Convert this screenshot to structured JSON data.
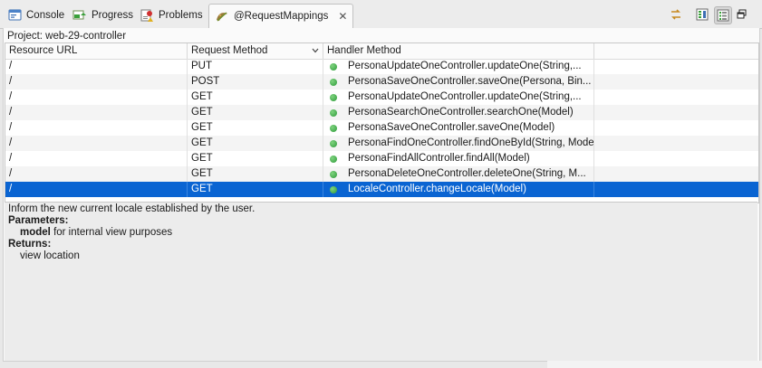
{
  "tabs": [
    {
      "label": "Console",
      "icon": "console-icon",
      "active": false
    },
    {
      "label": "Progress",
      "icon": "progress-icon",
      "active": false
    },
    {
      "label": "Problems",
      "icon": "problems-icon",
      "active": false
    },
    {
      "label": "@RequestMappings",
      "icon": "request-mappings-icon",
      "active": true
    }
  ],
  "toolbar": {
    "link_icon": "link-editor-icon",
    "layout_columns_icon": "layout-columns-icon",
    "layout_list_icon": "layout-list-icon",
    "minimize_icon": "maximize-restore-icon"
  },
  "project_label": "Project: web-29-controller",
  "table": {
    "headers": [
      "Resource URL",
      "Request Method",
      "Handler Method"
    ],
    "rows": [
      {
        "url": "/",
        "method": "PUT",
        "handler": "PersonaUpdateOneController.updateOne(String,..."
      },
      {
        "url": "/",
        "method": "POST",
        "handler": "PersonaSaveOneController.saveOne(Persona, Bin..."
      },
      {
        "url": "/",
        "method": "GET",
        "handler": "PersonaUpdateOneController.updateOne(String,..."
      },
      {
        "url": "/",
        "method": "GET",
        "handler": "PersonaSearchOneController.searchOne(Model)"
      },
      {
        "url": "/",
        "method": "GET",
        "handler": "PersonaSaveOneController.saveOne(Model)"
      },
      {
        "url": "/",
        "method": "GET",
        "handler": "PersonaFindOneController.findOneById(String, Model)"
      },
      {
        "url": "/",
        "method": "GET",
        "handler": "PersonaFindAllController.findAll(Model)"
      },
      {
        "url": "/",
        "method": "GET",
        "handler": "PersonaDeleteOneController.deleteOne(String, M..."
      },
      {
        "url": "/",
        "method": "GET",
        "handler": "LocaleController.changeLocale(Model)",
        "selected": true
      }
    ]
  },
  "description": {
    "summary": "Inform the new current locale established by the user.",
    "parameters_heading": "Parameters:",
    "param_name": "model",
    "param_desc": " for internal view purposes",
    "returns_heading": "Returns:",
    "returns_desc": "view location"
  },
  "colors": {
    "selection": "#0a64d2",
    "status_dot": "#2e9b3a"
  }
}
